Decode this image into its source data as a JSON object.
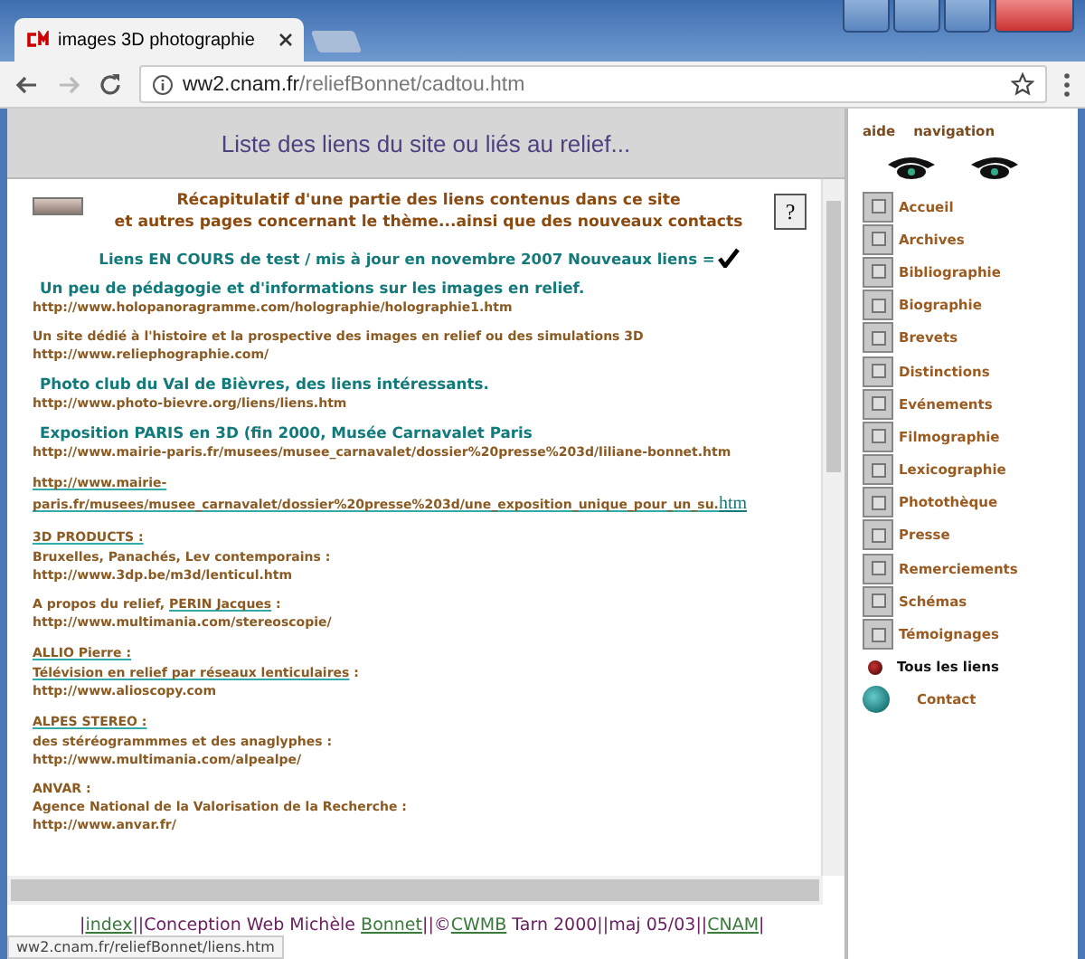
{
  "browser": {
    "tab_title": "images 3D photographie",
    "url_host": "ww2.cnam.fr",
    "url_path": "/reliefBonnet/cadtou.htm"
  },
  "page": {
    "header": "Liste des liens du site ou liés au relief...",
    "intro": [
      "Récapitulatif d'une partie des liens contenus dans ce site",
      "et autres pages concernant le thème...ainsi que des nouveaux contacts"
    ],
    "help_label": "?",
    "update_note": "Liens EN COURS de test / mis à jour en novembre 2007 Nouveaux liens  =",
    "blocks": [
      {
        "lines": [
          {
            "kind": "title",
            "text": "Un peu de pédagogie et d'informations sur les images en relief."
          },
          {
            "kind": "url",
            "text": "http://www.holopanoragramme.com/holographie/holographie1.htm"
          }
        ]
      },
      {
        "lines": [
          {
            "kind": "desc",
            "text": "Un site dédié à l'histoire et la prospective des images en relief ou des simulations 3D"
          },
          {
            "kind": "url",
            "text": "http://www.reliephographie.com/"
          }
        ]
      },
      {
        "lines": [
          {
            "kind": "title",
            "text": "Photo club du Val de Bièvres, des liens intéressants."
          },
          {
            "kind": "url",
            "text": "http://www.photo-bievre.org/liens/liens.htm"
          }
        ]
      },
      {
        "lines": [
          {
            "kind": "title",
            "text": "Exposition PARIS en 3D (fin 2000, Musée Carnavalet Paris"
          },
          {
            "kind": "url",
            "text": "http://www.mairie-paris.fr/musees/musee_carnavalet/dossier%20presse%203d/liliane-bonnet.htm"
          }
        ]
      },
      {
        "lines": [
          {
            "kind": "link",
            "text": "http://www.mairie-"
          },
          {
            "kind": "link",
            "text": "paris.fr/musees/musee_carnavalet/dossier%20presse%203d/une_exposition_unique_pour_un_su.",
            "tail": "htm"
          }
        ]
      },
      {
        "lines": [
          {
            "kind": "link",
            "text": "3D PRODUCTS :"
          },
          {
            "kind": "desc",
            "text": "Bruxelles, Panachés, Lev contemporains :"
          },
          {
            "kind": "url",
            "text": "http://www.3dp.be/m3d/lenticul.htm"
          }
        ]
      },
      {
        "lines": [
          {
            "kind": "mixed",
            "parts": [
              {
                "text": "A propos du relief, ",
                "link": false
              },
              {
                "text": "PERIN Jacques",
                "link": true
              },
              {
                "text": " :",
                "link": false
              }
            ]
          },
          {
            "kind": "url",
            "text": "http://www.multimania.com/stereoscopie/"
          }
        ]
      },
      {
        "lines": [
          {
            "kind": "link",
            "text": "ALLIO Pierre :"
          },
          {
            "kind": "mixed",
            "parts": [
              {
                "text": "Télévision en relief par réseaux lenticulaires",
                "link": true
              },
              {
                "text": " :",
                "link": false
              }
            ]
          },
          {
            "kind": "url",
            "text": "http://www.alioscopy.com"
          }
        ]
      },
      {
        "lines": [
          {
            "kind": "link",
            "text": "ALPES STEREO :"
          },
          {
            "kind": "desc",
            "text": "des stéréogrammmes et des anaglyphes :"
          },
          {
            "kind": "url",
            "text": "http://www.multimania.com/alpealpe/"
          }
        ]
      },
      {
        "lines": [
          {
            "kind": "desc",
            "text": "ANVAR :"
          },
          {
            "kind": "desc",
            "text": "Agence National de la Valorisation de la Recherche :"
          },
          {
            "kind": "url",
            "text": "http://www.anvar.fr/"
          }
        ]
      }
    ],
    "footer": [
      {
        "text": "|",
        "link": false
      },
      {
        "text": "index",
        "link": true
      },
      {
        "text": "||Conception Web Michèle ",
        "link": false
      },
      {
        "text": "Bonnet",
        "link": true
      },
      {
        "text": "||©",
        "link": false
      },
      {
        "text": "CWMB",
        "link": true
      },
      {
        "text": " Tarn 2000||maj 05/03||",
        "link": false
      },
      {
        "text": "CNAM",
        "link": true
      },
      {
        "text": "|",
        "link": false
      }
    ]
  },
  "nav": {
    "top": [
      "aide",
      "navigation"
    ],
    "items": [
      {
        "label": "Accueil",
        "kind": "box",
        "selected": false
      },
      {
        "label": "Archives",
        "kind": "box",
        "selected": false
      },
      {
        "label": "Bibliographie",
        "kind": "box",
        "selected": false
      },
      {
        "label": "Biographie",
        "kind": "box",
        "selected": false
      },
      {
        "label": "Brevets",
        "kind": "box",
        "selected": false
      },
      {
        "label": "Distinctions",
        "kind": "box",
        "selected": false
      },
      {
        "label": "Evénements",
        "kind": "box",
        "selected": false
      },
      {
        "label": "Filmographie",
        "kind": "box",
        "selected": false
      },
      {
        "label": "Lexicographie",
        "kind": "box",
        "selected": false
      },
      {
        "label": "Photothèque",
        "kind": "box",
        "selected": false
      },
      {
        "label": "Presse",
        "kind": "box",
        "selected": false
      },
      {
        "label": "Remerciements",
        "kind": "box",
        "selected": false
      },
      {
        "label": "Schémas",
        "kind": "box",
        "selected": false
      },
      {
        "label": "Témoignages",
        "kind": "box",
        "selected": false
      },
      {
        "label": "Tous les liens",
        "kind": "bullet",
        "selected": true
      },
      {
        "label": "Contact",
        "kind": "globe",
        "selected": false
      }
    ]
  },
  "status_url": "ww2.cnam.fr/reliefBonnet/liens.htm"
}
